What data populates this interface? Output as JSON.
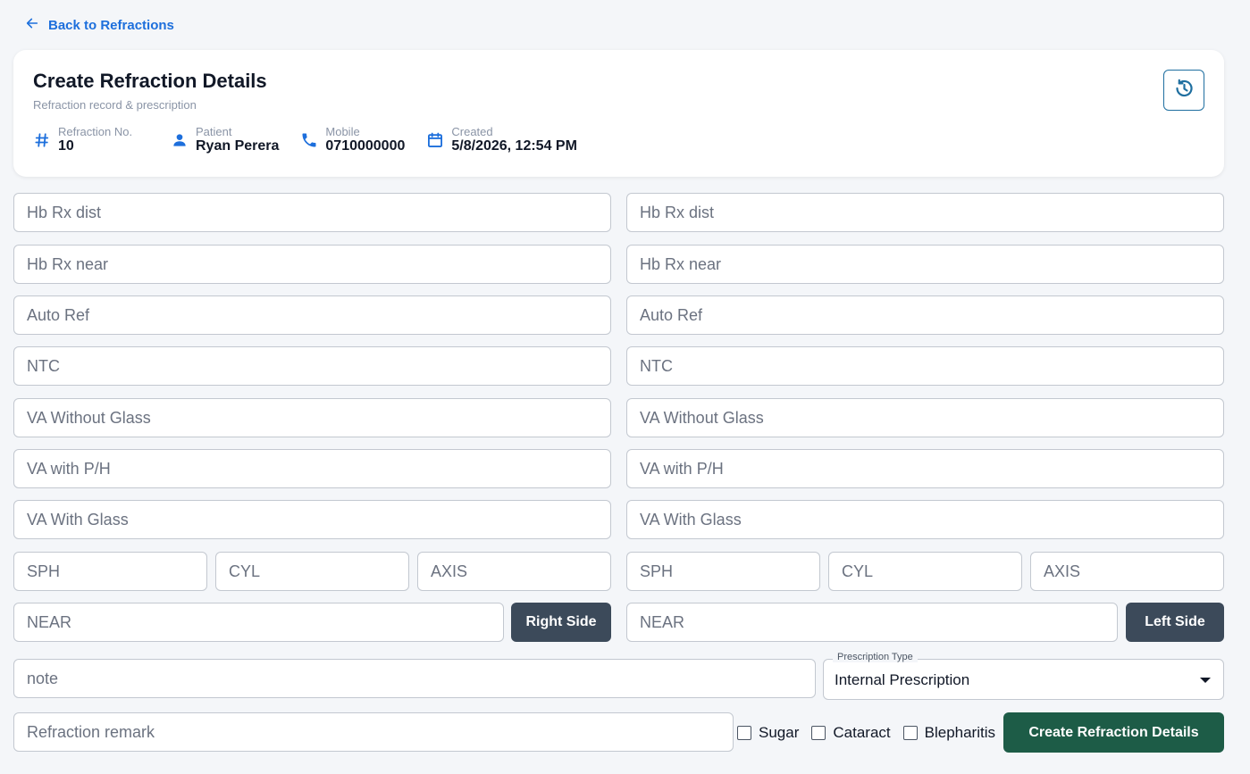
{
  "nav": {
    "back_label": "Back to Refractions"
  },
  "header": {
    "title": "Create Refraction Details",
    "subtitle": "Refraction record & prescription",
    "meta": {
      "refraction_no_label": "Refraction No.",
      "refraction_no": "10",
      "patient_label": "Patient",
      "patient": "Ryan Perera",
      "mobile_label": "Mobile",
      "mobile": "0710000000",
      "created_label": "Created",
      "created": "5/8/2026, 12:54 PM"
    },
    "icons": {
      "back": "arrow-left-icon",
      "history": "history-icon",
      "refraction_no": "hash-icon",
      "patient": "person-icon",
      "mobile": "phone-icon",
      "created": "calendar-icon"
    }
  },
  "right_eye": {
    "hb_rx_dist": {
      "placeholder": "Hb Rx dist",
      "value": ""
    },
    "hb_rx_near": {
      "placeholder": "Hb Rx near",
      "value": ""
    },
    "auto_ref": {
      "placeholder": "Auto Ref",
      "value": ""
    },
    "ntc": {
      "placeholder": "NTC",
      "value": ""
    },
    "va_without_glass": {
      "placeholder": "VA Without Glass",
      "value": ""
    },
    "va_with_ph": {
      "placeholder": "VA with P/H",
      "value": ""
    },
    "va_with_glass": {
      "placeholder": "VA With Glass",
      "value": ""
    },
    "sph": {
      "placeholder": "SPH",
      "value": ""
    },
    "cyl": {
      "placeholder": "CYL",
      "value": ""
    },
    "axis": {
      "placeholder": "AXIS",
      "value": ""
    },
    "near": {
      "placeholder": "NEAR",
      "value": ""
    },
    "side_button": "Right Side"
  },
  "left_eye": {
    "hb_rx_dist": {
      "placeholder": "Hb Rx dist",
      "value": ""
    },
    "hb_rx_near": {
      "placeholder": "Hb Rx near",
      "value": ""
    },
    "auto_ref": {
      "placeholder": "Auto Ref",
      "value": ""
    },
    "ntc": {
      "placeholder": "NTC",
      "value": ""
    },
    "va_without_glass": {
      "placeholder": "VA Without Glass",
      "value": ""
    },
    "va_with_ph": {
      "placeholder": "VA with P/H",
      "value": ""
    },
    "va_with_glass": {
      "placeholder": "VA With Glass",
      "value": ""
    },
    "sph": {
      "placeholder": "SPH",
      "value": ""
    },
    "cyl": {
      "placeholder": "CYL",
      "value": ""
    },
    "axis": {
      "placeholder": "AXIS",
      "value": ""
    },
    "near": {
      "placeholder": "NEAR",
      "value": ""
    },
    "side_button": "Left Side"
  },
  "footer": {
    "note": {
      "placeholder": "note",
      "value": ""
    },
    "prescription_type": {
      "label": "Prescription Type",
      "value": "Internal Prescription"
    },
    "refraction_remark": {
      "placeholder": "Refraction remark",
      "value": ""
    },
    "checkboxes": [
      {
        "label": "Sugar",
        "checked": false
      },
      {
        "label": "Cataract",
        "checked": false
      },
      {
        "label": "Blepharitis",
        "checked": false
      }
    ],
    "submit_label": "Create Refraction Details"
  },
  "colors": {
    "accent": "#1d6fdc",
    "side_button": "#3c4a5a",
    "submit": "#1d5c47",
    "background": "#f4f6f9"
  }
}
